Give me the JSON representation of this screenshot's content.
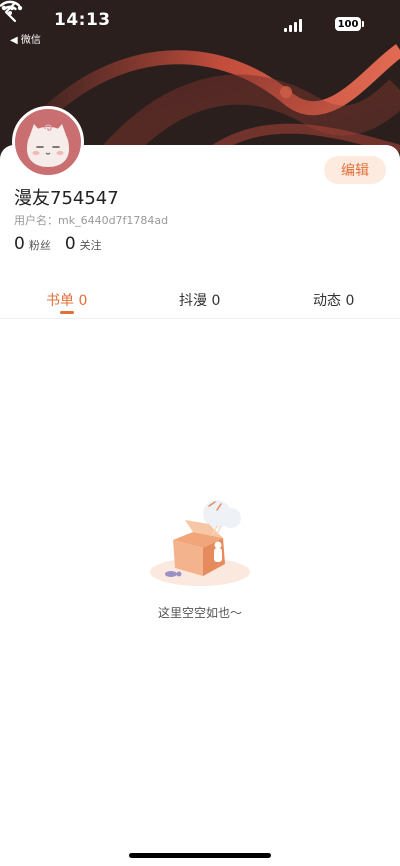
{
  "status_bar": {
    "time": "14:13",
    "back_app": "◀ 微信",
    "battery": "100"
  },
  "profile": {
    "nickname": "漫友754547",
    "username": "用户名：mk_6440d7f1784ad",
    "followers_count": "0",
    "followers_label": "粉丝",
    "following_count": "0",
    "following_label": "关注",
    "edit_label": "编辑"
  },
  "tabs": [
    {
      "label": "书单 0",
      "active": true
    },
    {
      "label": "抖漫 0",
      "active": false
    },
    {
      "label": "动态 0",
      "active": false
    }
  ],
  "empty_state": {
    "text": "这里空空如也～"
  },
  "colors": {
    "header_bg": "#2a1f1d",
    "accent": "#e2703a",
    "edit_bg": "#fdebe0",
    "avatar_bg": "#c96f72"
  },
  "icons": [
    "back-icon",
    "more-icon",
    "signal-icon",
    "wifi-icon",
    "battery-icon",
    "empty-box-illustration"
  ]
}
